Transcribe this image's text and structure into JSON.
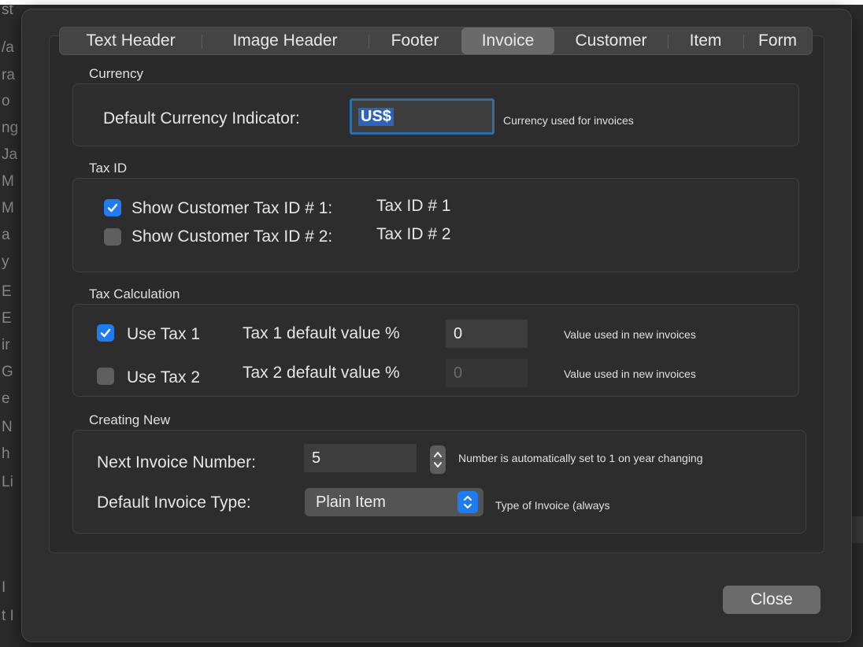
{
  "background": {
    "fragments": [
      "st",
      "/a",
      "ra",
      "o",
      "ng",
      "Ja",
      "M",
      "M",
      "a",
      "y",
      "E",
      "E",
      "ir",
      "G",
      "e",
      "N",
      "h",
      "Li",
      "I",
      "t I"
    ]
  },
  "tabs": [
    {
      "label": "Text Header",
      "selected": false
    },
    {
      "label": "Image Header",
      "selected": false
    },
    {
      "label": "Footer",
      "selected": false
    },
    {
      "label": "Invoice",
      "selected": true
    },
    {
      "label": "Customer",
      "selected": false
    },
    {
      "label": "Item",
      "selected": false
    },
    {
      "label": "Form",
      "selected": false
    }
  ],
  "currency": {
    "section_label": "Currency",
    "indicator_label": "Default Currency Indicator:",
    "indicator_value": "US$",
    "note": "Currency used for invoices"
  },
  "tax_id": {
    "section_label": "Tax ID",
    "show_1_label": "Show Customer Tax ID # 1:",
    "show_1_checked": true,
    "show_1_value": "Tax ID # 1",
    "show_2_label": "Show Customer Tax ID # 2:",
    "show_2_checked": false,
    "show_2_value": "Tax ID # 2"
  },
  "tax_calc": {
    "section_label": "Tax Calculation",
    "use_tax_1_label": "Use Tax 1",
    "use_tax_1_checked": true,
    "tax_1_default_label": "Tax 1 default value %",
    "tax_1_value": "0",
    "tax_1_note": "Value used in new invoices",
    "use_tax_2_label": "Use Tax 2",
    "use_tax_2_checked": false,
    "tax_2_default_label": "Tax 2 default value %",
    "tax_2_value": "0",
    "tax_2_note": "Value used in new invoices"
  },
  "creating_new": {
    "section_label": "Creating New",
    "next_number_label": "Next Invoice Number:",
    "next_number_value": "5",
    "next_number_note": "Number is automatically set to 1 on year changing",
    "default_type_label": "Default Invoice Type:",
    "default_type_value": "Plain Item",
    "default_type_note": "Type of Invoice (always"
  },
  "buttons": {
    "close_label": "Close"
  },
  "colors": {
    "accent": "#1f7bf0",
    "focus_ring": "#2b6ea6",
    "sheet_background": "#2f2f2f"
  }
}
